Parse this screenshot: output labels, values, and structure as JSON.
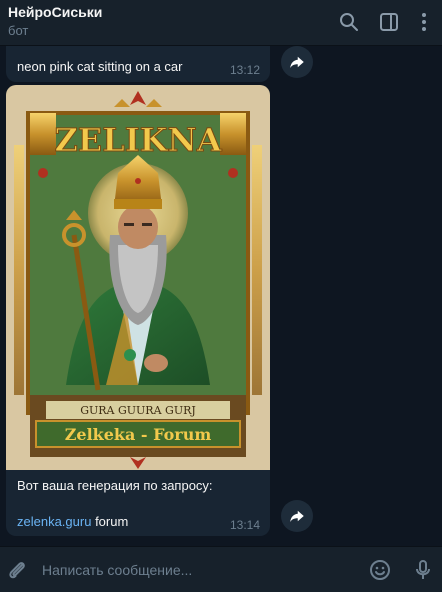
{
  "header": {
    "title": "НейроСиськи",
    "status": "бот",
    "icons": [
      "search-icon",
      "sidebar-toggle-icon",
      "more-vertical-icon"
    ]
  },
  "messages": [
    {
      "text": "neon pink cat sitting on a car",
      "time": "13:12"
    },
    {
      "image": {
        "banner_title": "ZELIKNA",
        "scroll_text": "GURA GUURA GURJ",
        "plaque_text": "Zelkeka - Forum"
      },
      "caption": "Вот ваша генерация по запросу:",
      "link_text": "zelenka.guru",
      "link_suffix": " forum",
      "time": "13:14"
    }
  ],
  "input": {
    "placeholder": "Написать сообщение...",
    "icons": [
      "attach-icon",
      "emoji-icon",
      "microphone-icon"
    ]
  },
  "colors": {
    "background": "#0e1621",
    "panel": "#17212b",
    "bubble": "#182533",
    "link": "#6ab3f3",
    "muted": "#6d7f8f"
  }
}
